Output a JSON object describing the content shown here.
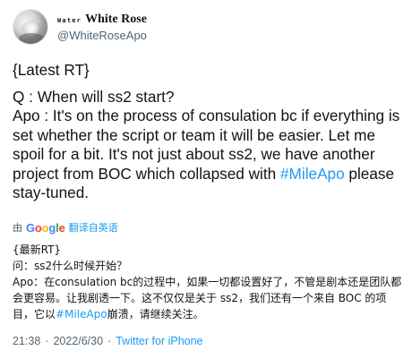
{
  "author": {
    "name_prefix": "Water",
    "display_name": "White Rose",
    "handle": "@WhiteRoseApo"
  },
  "tweet": {
    "lines": [
      "{Latest RT}",
      "Q : When will ss2 start?",
      "Apo : It's on the process of consulation bc if everything is set whether the script or team it will be easier. Let me spoil for a bit. It's not just about ss2, we have another project from BOC which collapsed with "
    ],
    "hashtag": "#MileApo",
    "tail": " please stay-tuned."
  },
  "translate_bar": {
    "by_label": "由",
    "brand": "Google",
    "link_label": "翻译自英语"
  },
  "translation": {
    "lines": [
      "{最新RT}",
      "问：ss2什么时候开始？",
      "Apo：在consulation bc的过程中，如果一切都设置好了，不管是剧本还是团队都会更容易。让我剧透一下。这不仅仅是关于 ss2，我们还有一个来自 BOC 的项目，它以"
    ],
    "hashtag": "#MileApo",
    "tail": "崩溃，请继续关注。"
  },
  "meta": {
    "time": "21:38",
    "separator": "·",
    "date": "2022/6/30",
    "source": "Twitter for iPhone"
  }
}
